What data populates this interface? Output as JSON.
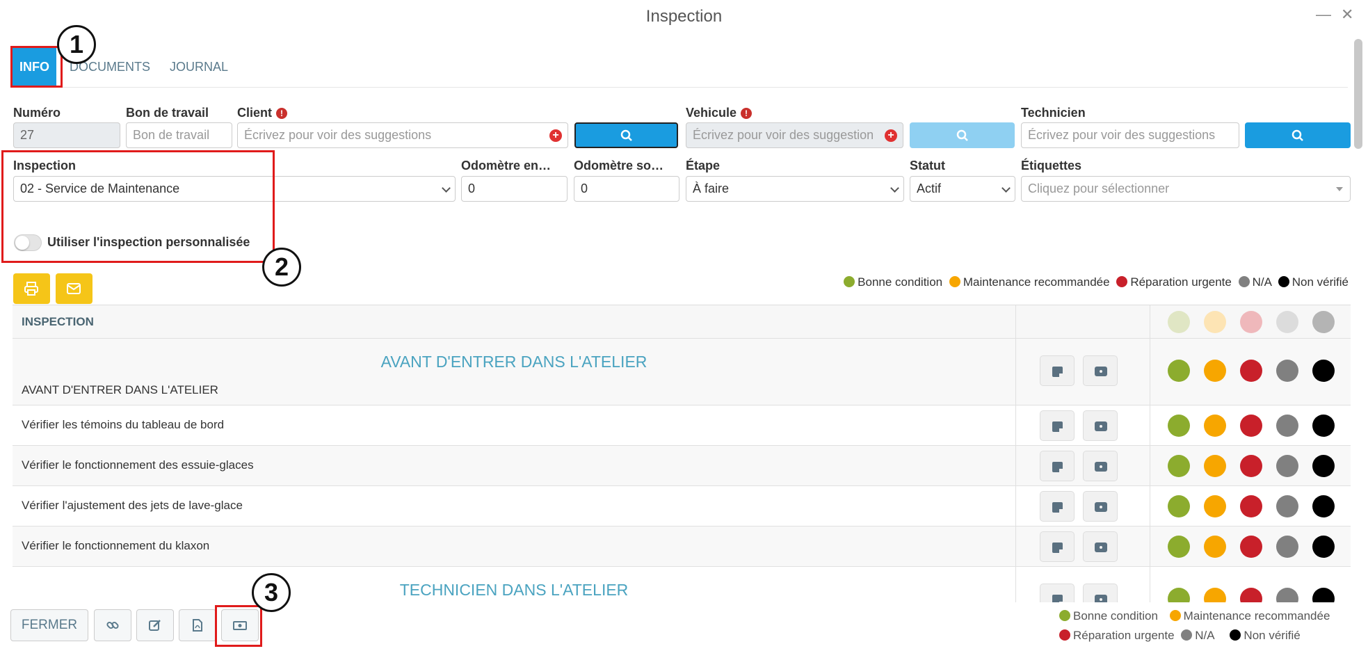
{
  "window": {
    "title": "Inspection",
    "minimize_glyph": "—",
    "close_glyph": "✕"
  },
  "tabs": [
    {
      "label": "INFO",
      "active": true
    },
    {
      "label": "DOCUMENTS",
      "active": false
    },
    {
      "label": "JOURNAL",
      "active": false
    }
  ],
  "form": {
    "numero": {
      "label": "Numéro",
      "value": "27"
    },
    "bon_de_travail": {
      "label": "Bon de travail",
      "placeholder": "Bon de travail"
    },
    "client": {
      "label": "Client",
      "placeholder": "Écrivez pour voir des suggestions",
      "required": true
    },
    "vehicule": {
      "label": "Vehicule",
      "placeholder": "Écrivez pour voir des suggestion",
      "required": true
    },
    "technicien": {
      "label": "Technicien",
      "placeholder": "Écrivez pour voir des suggestions"
    },
    "inspection": {
      "label": "Inspection",
      "value": "02 - Service de Maintenance"
    },
    "odometre_entree": {
      "label": "Odomètre en…",
      "value": "0"
    },
    "odometre_sortie": {
      "label": "Odomètre so…",
      "value": "0"
    },
    "etape": {
      "label": "Étape",
      "value": "À faire"
    },
    "statut": {
      "label": "Statut",
      "value": "Actif"
    },
    "etiquettes": {
      "label": "Étiquettes",
      "placeholder": "Cliquez pour sélectionner"
    },
    "custom_toggle": {
      "label": "Utiliser l'inspection personnalisée",
      "checked": false
    },
    "required_glyph": "!",
    "add_glyph": "+"
  },
  "legend": {
    "items": [
      {
        "label": "Bonne condition",
        "color": "#8cac2e"
      },
      {
        "label": "Maintenance recommandée",
        "color": "#f7a600"
      },
      {
        "label": "Réparation urgente",
        "color": "#c8202a"
      },
      {
        "label": "N/A",
        "color": "#808080"
      },
      {
        "label": "Non vérifié",
        "color": "#000000"
      }
    ]
  },
  "legend_faded_colors": [
    "#e0e6c4",
    "#fde4b4",
    "#efb8bb",
    "#dcdcdc",
    "#b4b4b4"
  ],
  "table": {
    "header": "INSPECTION",
    "rows": [
      {
        "section_title": "AVANT D'ENTRER DANS L'ATELIER",
        "text": "AVANT D'ENTRER DANS L'ATELIER"
      },
      {
        "text": "Vérifier les témoins du tableau de bord"
      },
      {
        "text": "Vérifier le fonctionnement des essuie-glaces"
      },
      {
        "text": "Vérifier l'ajustement des jets de lave-glace"
      },
      {
        "text": "Vérifier le fonctionnement du klaxon"
      },
      {
        "section_title": "TECHNICIEN DANS L'ATELIER",
        "text": ""
      }
    ]
  },
  "footer": {
    "close_label": "FERMER"
  },
  "markers": [
    "1",
    "2",
    "3"
  ]
}
